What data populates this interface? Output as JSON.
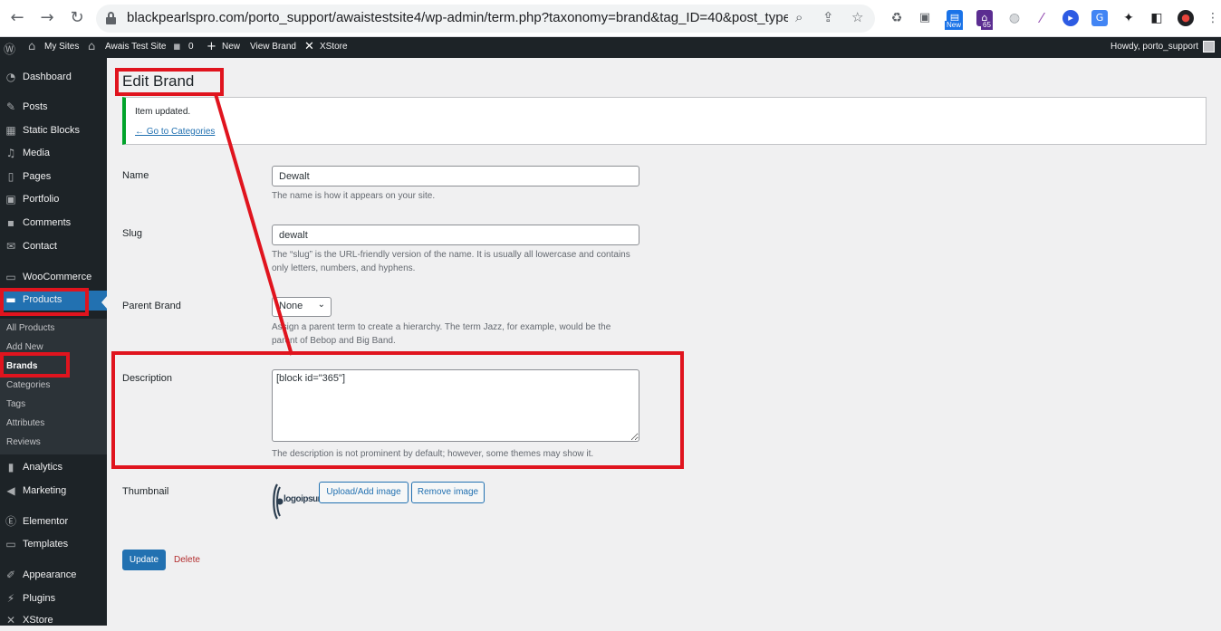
{
  "browser": {
    "url": "blackpearlspro.com/porto_support/awaistestsite4/wp-admin/term.php?taxonomy=brand&tag_ID=40&post_type=p...",
    "ext_badge_new": "New",
    "ext_badge_count": "65"
  },
  "adminbar": {
    "my_sites": "My Sites",
    "site_name": "Awais Test Site",
    "comments_count": "0",
    "new": "New",
    "view_brand": "View Brand",
    "xstore": "XStore",
    "howdy": "Howdy, porto_support"
  },
  "sidebar": {
    "items": [
      {
        "label": "Dashboard",
        "icon": "dashboard-icon"
      },
      {
        "label": "Posts",
        "icon": "pin-icon"
      },
      {
        "label": "Static Blocks",
        "icon": "blocks-icon"
      },
      {
        "label": "Media",
        "icon": "media-icon"
      },
      {
        "label": "Pages",
        "icon": "pages-icon"
      },
      {
        "label": "Portfolio",
        "icon": "portfolio-icon"
      },
      {
        "label": "Comments",
        "icon": "comment-icon"
      },
      {
        "label": "Contact",
        "icon": "mail-icon"
      },
      {
        "label": "WooCommerce",
        "icon": "woo-icon"
      },
      {
        "label": "Products",
        "icon": "products-icon"
      },
      {
        "label": "Analytics",
        "icon": "analytics-icon"
      },
      {
        "label": "Marketing",
        "icon": "megaphone-icon"
      },
      {
        "label": "Elementor",
        "icon": "elementor-icon"
      },
      {
        "label": "Templates",
        "icon": "folder-icon"
      },
      {
        "label": "Appearance",
        "icon": "brush-icon"
      },
      {
        "label": "Plugins",
        "icon": "plugin-icon"
      },
      {
        "label": "XStore",
        "icon": "xstore-icon"
      }
    ],
    "submenu": [
      "All Products",
      "Add New",
      "Brands",
      "Categories",
      "Tags",
      "Attributes",
      "Reviews"
    ]
  },
  "page": {
    "title": "Edit Brand",
    "notice_text": "Item updated.",
    "notice_link": "← Go to Categories",
    "name_label": "Name",
    "name_value": "Dewalt",
    "name_help": "The name is how it appears on your site.",
    "slug_label": "Slug",
    "slug_value": "dewalt",
    "slug_help": "The “slug” is the URL-friendly version of the name. It is usually all lowercase and contains only letters, numbers, and hyphens.",
    "parent_label": "Parent Brand",
    "parent_value": "None",
    "parent_help": "Assign a parent term to create a hierarchy. The term Jazz, for example, would be the parent of Bebop and Big Band.",
    "description_label": "Description",
    "description_value": "[block id=\"365\"]",
    "description_help": "The description is not prominent by default; however, some themes may show it.",
    "thumbnail_label": "Thumbnail",
    "logo_text": "logoipsum",
    "upload_button": "Upload/Add image",
    "remove_button": "Remove image",
    "update_button": "Update",
    "delete_link": "Delete"
  },
  "colors": {
    "annotation": "#e0141e",
    "wp_blue": "#2271b1",
    "admin_dark": "#1d2327"
  }
}
